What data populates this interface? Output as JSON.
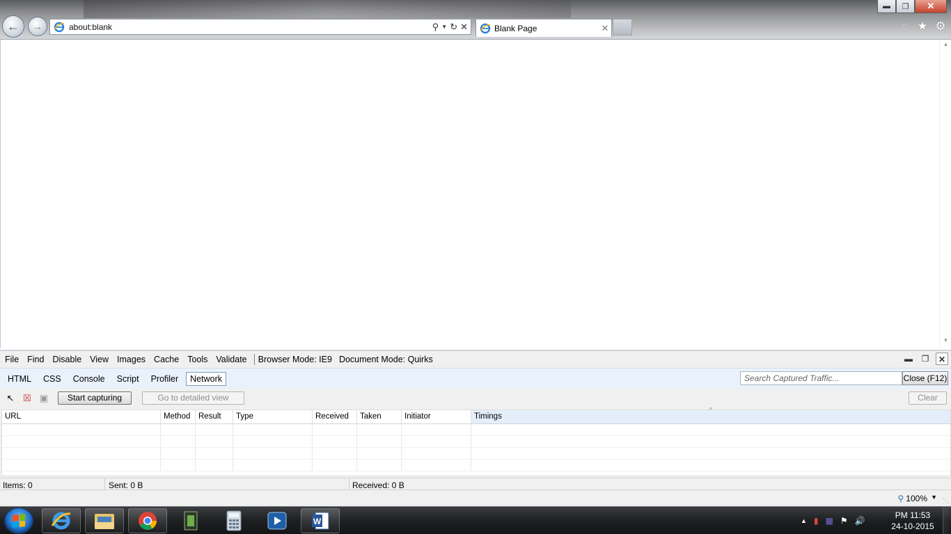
{
  "browser": {
    "address": "about:blank",
    "tab_title": "Blank Page",
    "window_controls": [
      "minimize-icon",
      "restore-icon",
      "close-icon"
    ]
  },
  "devtools": {
    "menu": [
      "File",
      "Find",
      "Disable",
      "View",
      "Images",
      "Cache",
      "Tools",
      "Validate"
    ],
    "browser_mode_label": "Browser Mode:",
    "browser_mode_value": "IE9",
    "document_mode_label": "Document Mode:",
    "document_mode_value": "Quirks",
    "tabs": [
      "HTML",
      "CSS",
      "Console",
      "Script",
      "Profiler",
      "Network"
    ],
    "active_tab": "Network",
    "search_placeholder": "Search Captured Traffic...",
    "close_label": "Close (F12)",
    "start_capturing_label": "Start capturing",
    "detailed_view_label": "Go to detailed view",
    "clear_label": "Clear",
    "columns": [
      "URL",
      "Method",
      "Result",
      "Type",
      "Received",
      "Taken",
      "Initiator",
      "Timings"
    ],
    "status": {
      "items": "Items: 0",
      "sent": "Sent: 0 B",
      "received": "Received: 0 B"
    }
  },
  "statusbar": {
    "zoom": "100%"
  },
  "taskbar": {
    "apps": [
      "internet-explorer",
      "windows-explorer",
      "google-chrome",
      "media-app",
      "calculator",
      "media-player",
      "microsoft-word"
    ],
    "clock_time": "PM 11:53",
    "clock_date": "24-10-2015"
  },
  "colors": {
    "devtools_tabbar": "#e9f2fb",
    "timings_header": "#e4eefa",
    "taskbar": "#1e1f21",
    "close_button": "#c7432b"
  }
}
